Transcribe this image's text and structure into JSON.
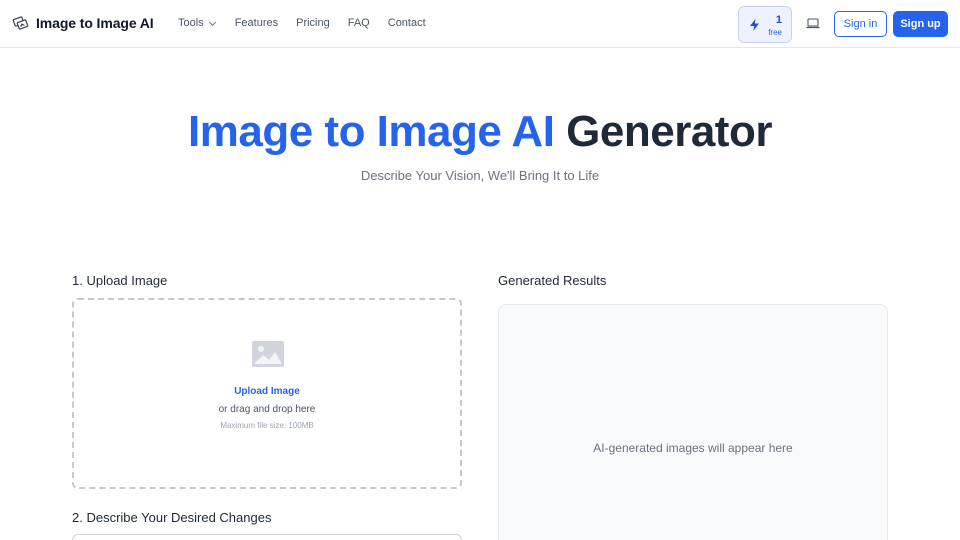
{
  "header": {
    "brand": "Image to Image AI",
    "nav": [
      {
        "label": "Tools",
        "has_dropdown": true
      },
      {
        "label": "Features"
      },
      {
        "label": "Pricing"
      },
      {
        "label": "FAQ"
      },
      {
        "label": "Contact"
      }
    ],
    "credits": {
      "count": "1",
      "label": "free"
    },
    "sign_in": "Sign in",
    "sign_up": "Sign up"
  },
  "hero": {
    "title_accent": "Image to Image AI",
    "title_rest": "Generator",
    "subtitle": "Describe Your Vision, We'll Bring It to Life"
  },
  "upload": {
    "heading": "1. Upload Image",
    "link": "Upload Image",
    "hint": "or drag and drop here",
    "max_size": "Maximum file size: 100MB"
  },
  "describe": {
    "heading": "2. Describe Your Desired Changes"
  },
  "results": {
    "heading": "Generated Results",
    "empty_text": "AI-generated images will appear here"
  },
  "colors": {
    "accent": "#2563eb",
    "border": "#e5e7eb",
    "text": "#1f2937",
    "muted": "#6b7280"
  },
  "icons": [
    "logo-icon",
    "chevron-down-icon",
    "bolt-icon",
    "laptop-icon",
    "image-icon"
  ]
}
